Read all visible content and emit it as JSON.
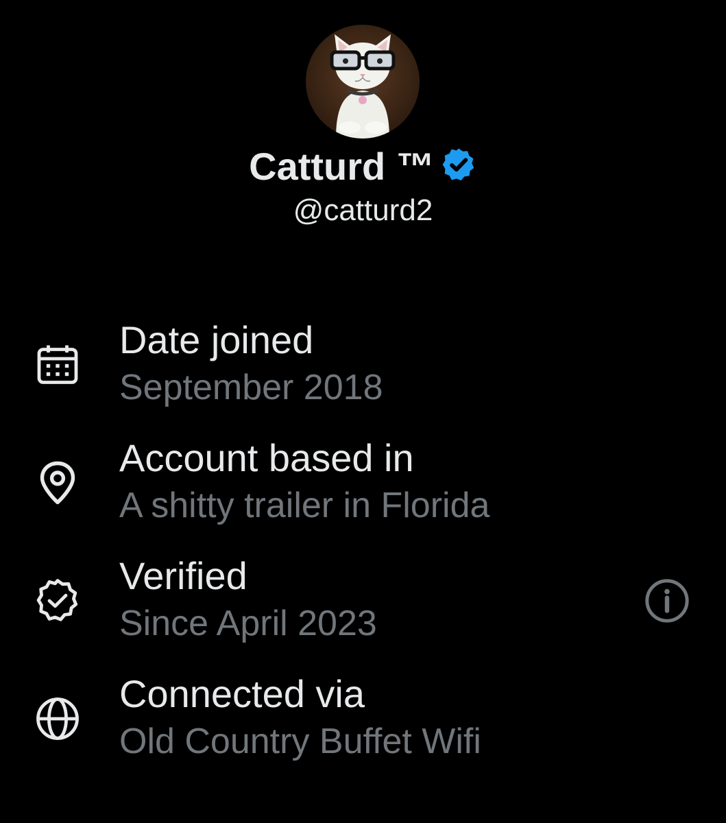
{
  "profile": {
    "display_name": "Catturd ™",
    "handle": "@catturd2",
    "avatar_icon": "cat-with-glasses-avatar",
    "verified_badge_icon": "verified-badge-icon",
    "badge_color": "#1d9bf0"
  },
  "about": {
    "items": [
      {
        "icon": "calendar-icon",
        "label": "Date joined",
        "value": "September 2018"
      },
      {
        "icon": "location-pin-icon",
        "label": "Account based in",
        "value": "A shitty trailer in Florida"
      },
      {
        "icon": "verified-check-icon",
        "label": "Verified",
        "value": "Since April 2023",
        "action_icon": "info-icon"
      },
      {
        "icon": "globe-icon",
        "label": "Connected via",
        "value": "Old Country Buffet Wifi"
      }
    ]
  },
  "colors": {
    "background": "#000000",
    "primary_text": "#e7e9ea",
    "secondary_text": "#71767b",
    "accent": "#1d9bf0"
  }
}
